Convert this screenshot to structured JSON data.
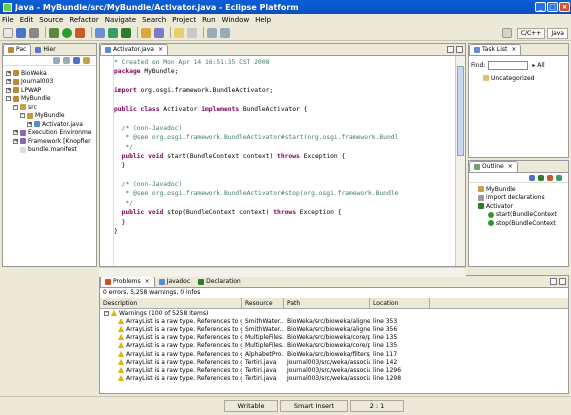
{
  "window": {
    "title": "Java - MyBundle/src/MyBundle/Activator.java - Eclipse Platform"
  },
  "menu": [
    "File",
    "Edit",
    "Source",
    "Refactor",
    "Navigate",
    "Search",
    "Project",
    "Run",
    "Window",
    "Help"
  ],
  "perspectives": {
    "cpp": "C/C++",
    "java": "Java"
  },
  "left_panel": {
    "tabs": [
      "Pac",
      "Hier"
    ],
    "tree": [
      {
        "label": "BioWeka",
        "level": 0,
        "toggle": "+"
      },
      {
        "label": "Journal003",
        "level": 0,
        "toggle": "+"
      },
      {
        "label": "LPWAP",
        "level": 0,
        "toggle": "+"
      },
      {
        "label": "MyBundle",
        "level": 0,
        "toggle": "-"
      },
      {
        "label": "src",
        "level": 1,
        "toggle": "-"
      },
      {
        "label": "MyBundle",
        "level": 2,
        "toggle": "-"
      },
      {
        "label": "Activator.java",
        "level": 3,
        "toggle": "+"
      },
      {
        "label": "Execution Environme",
        "level": 1,
        "toggle": "+"
      },
      {
        "label": "Framework [Knopfler",
        "level": 1,
        "toggle": "+"
      },
      {
        "label": "bundle.manifest",
        "level": 1,
        "toggle": ""
      }
    ]
  },
  "editor": {
    "tab": "Activator.java",
    "lines": [
      [
        {
          "t": "* Created on Mon Apr 14 16:51:35 CST 2008",
          "c": "cm"
        }
      ],
      [
        {
          "t": "package",
          "c": "kw"
        },
        {
          "t": " MyBundle;",
          "c": ""
        }
      ],
      [
        {
          "t": "",
          "c": ""
        }
      ],
      [
        {
          "t": "import",
          "c": "kw"
        },
        {
          "t": " org.osgi.framework.BundleActivator;",
          "c": ""
        }
      ],
      [
        {
          "t": "",
          "c": ""
        }
      ],
      [
        {
          "t": "public class",
          "c": "kw"
        },
        {
          "t": " Activator ",
          "c": ""
        },
        {
          "t": "implements",
          "c": "kw"
        },
        {
          "t": " BundleActivator {",
          "c": ""
        }
      ],
      [
        {
          "t": "",
          "c": ""
        }
      ],
      [
        {
          "t": "  /* (non-Javadoc)",
          "c": "cm"
        }
      ],
      [
        {
          "t": "   * @see org.osgi.framework.BundleActivator#start(org.osgi.framework.Bundl",
          "c": "cm"
        }
      ],
      [
        {
          "t": "   */",
          "c": "cm"
        }
      ],
      [
        {
          "t": "  public void",
          "c": "kw"
        },
        {
          "t": " start(BundleContext context) ",
          "c": ""
        },
        {
          "t": "throws",
          "c": "kw"
        },
        {
          "t": " Exception {",
          "c": ""
        }
      ],
      [
        {
          "t": "  }",
          "c": ""
        }
      ],
      [
        {
          "t": "",
          "c": ""
        }
      ],
      [
        {
          "t": "  /* (non-Javadoc)",
          "c": "cm"
        }
      ],
      [
        {
          "t": "   * @see org.osgi.framework.BundleActivator#stop(org.osgi.framework.Bundle",
          "c": "cm"
        }
      ],
      [
        {
          "t": "   */",
          "c": "cm"
        }
      ],
      [
        {
          "t": "  public void",
          "c": "kw"
        },
        {
          "t": " stop(BundleContext context) ",
          "c": ""
        },
        {
          "t": "throws",
          "c": "kw"
        },
        {
          "t": " Exception {",
          "c": ""
        }
      ],
      [
        {
          "t": "  }",
          "c": ""
        }
      ],
      [
        {
          "t": "}",
          "c": ""
        }
      ]
    ]
  },
  "task_list": {
    "tab": "Task List",
    "find_label": "Find:",
    "all_label": "All",
    "category": "Uncategorized"
  },
  "outline": {
    "tab": "Outline",
    "items": [
      {
        "label": "MyBundle",
        "level": 0
      },
      {
        "label": "import declarations",
        "level": 0
      },
      {
        "label": "Activator",
        "level": 0
      },
      {
        "label": "start(BundleContext",
        "level": 1
      },
      {
        "label": "stop(BundleContext",
        "level": 1
      }
    ]
  },
  "problems": {
    "tabs": [
      "Problems",
      "Javadoc",
      "Declaration"
    ],
    "summary": "0 errors, 5,258 warnings, 0 infos",
    "columns": [
      "Description",
      "Resource",
      "Path",
      "Location"
    ],
    "group": "Warnings (100 of 5258 items)",
    "rows": [
      {
        "desc": "ArrayList is a raw type. References to ge",
        "res": "SmithWater...",
        "path": "BioWeka/src/bioweka/aligne...",
        "loc": "line 353"
      },
      {
        "desc": "ArrayList is a raw type. References to ge",
        "res": "SmithWater...",
        "path": "BioWeka/src/bioweka/aligne...",
        "loc": "line 356"
      },
      {
        "desc": "ArrayList is a raw type. References to ge",
        "res": "MultipleFiles...",
        "path": "BioWeka/src/bioweka/core/p...",
        "loc": "line 135"
      },
      {
        "desc": "ArrayList is a raw type. References to ge",
        "res": "MultipleFiles...",
        "path": "BioWeka/src/bioweka/core/p...",
        "loc": "line 135"
      },
      {
        "desc": "ArrayList is a raw type. References to ge",
        "res": "AlphabetPro...",
        "path": "BioWeka/src/bioweka/filters/...",
        "loc": "line 117"
      },
      {
        "desc": "ArrayList is a raw type. References to ge",
        "res": "Tertiri.java",
        "path": "Journal003/src/weka/associati...",
        "loc": "line 142"
      },
      {
        "desc": "ArrayList is a raw type. References to ge",
        "res": "Tertiri.java",
        "path": "Journal003/src/weka/associati...",
        "loc": "line 1296"
      },
      {
        "desc": "ArrayList is a raw type. References to ge",
        "res": "Tertiri.java",
        "path": "Journal003/src/weka/associati...",
        "loc": "line 1298"
      }
    ]
  },
  "status": {
    "writable": "Writable",
    "insert": "Smart Insert",
    "position": "2 : 1"
  },
  "colors": {
    "title_bar": "#0b4fc0",
    "keyword": "#7f0055",
    "comment": "#3f7f5f",
    "warning": "#e0b400"
  },
  "icons": [
    "java-app-icon",
    "new-icon",
    "save-icon",
    "print-icon",
    "debug-icon",
    "run-icon",
    "search-icon",
    "open-perspective-icon",
    "warning-icon",
    "package-icon",
    "class-icon",
    "method-icon"
  ]
}
